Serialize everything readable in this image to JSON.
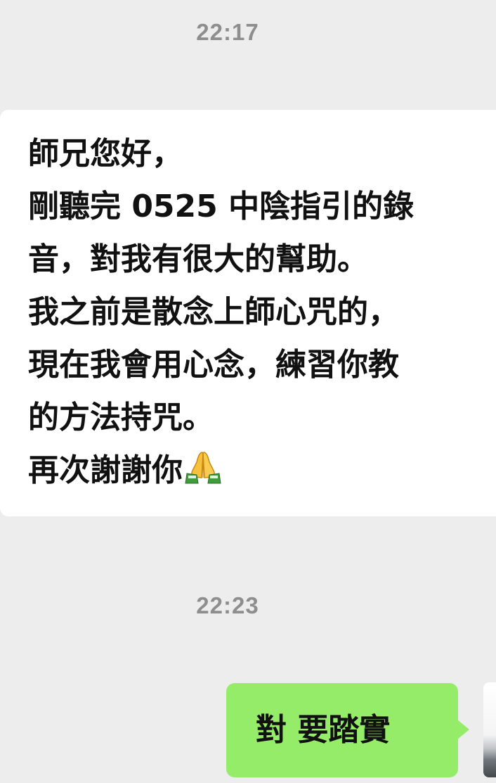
{
  "chat": {
    "timestamp_1": "22:17",
    "incoming_message": {
      "lines": [
        "師兄您好，",
        "剛聽完 0525 中陰指引的錄",
        "音，對我有很大的幫助。",
        "我之前是散念上師心咒的，",
        "現在我會用心念，練習你教",
        "的方法持咒。",
        "再次謝謝你"
      ],
      "emoji": "folded-hands-icon"
    },
    "timestamp_2": "22:23",
    "outgoing_message": {
      "text": "對  要踏實"
    }
  },
  "colors": {
    "background": "#ededed",
    "incoming_bubble": "#ffffff",
    "outgoing_bubble": "#95ec69",
    "timestamp_text": "#8e8e8e",
    "message_text": "#111111"
  }
}
